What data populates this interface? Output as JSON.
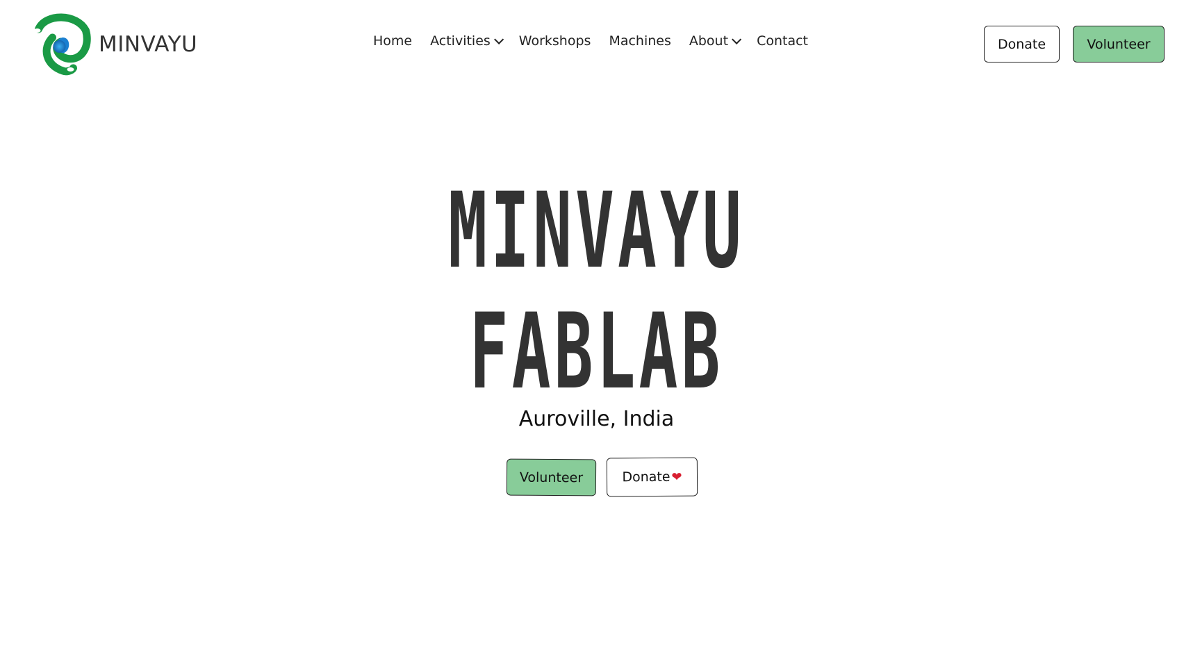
{
  "brand": {
    "name": "MINVAYU",
    "colors": {
      "green": "#1a9a45",
      "blue": "#1a7fd0",
      "accent": "#88cc99",
      "heart": "#d81e30"
    }
  },
  "nav": {
    "items": [
      {
        "label": "Home",
        "dropdown": false
      },
      {
        "label": "Activities",
        "dropdown": true
      },
      {
        "label": "Workshops",
        "dropdown": false
      },
      {
        "label": "Machines",
        "dropdown": false
      },
      {
        "label": "About",
        "dropdown": true
      },
      {
        "label": "Contact",
        "dropdown": false
      }
    ]
  },
  "header": {
    "donate_label": "Donate",
    "volunteer_label": "Volunteer"
  },
  "hero": {
    "title_line1": "MINVAYU",
    "title_line2": "FABLAB",
    "subtitle": "Auroville, India",
    "volunteer_label": "Volunteer",
    "donate_label": "Donate",
    "heart_icon": "heart-icon"
  }
}
